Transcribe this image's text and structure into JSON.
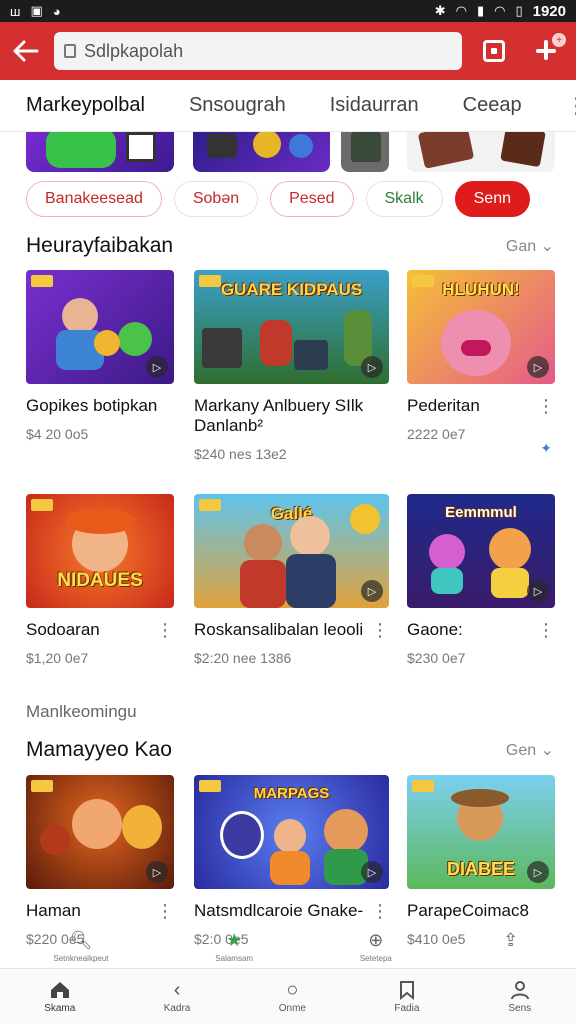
{
  "status_bar": {
    "time": "1920"
  },
  "app_bar": {
    "search_value": "Sdlpkapolah"
  },
  "tabs": [
    {
      "label": "Markeypolbal"
    },
    {
      "label": "Snsougrah"
    },
    {
      "label": "Isidaurran"
    },
    {
      "label": "Ceeap"
    }
  ],
  "chips": [
    {
      "label": "Banakeesead"
    },
    {
      "label": "Sobən"
    },
    {
      "label": "Pesed"
    },
    {
      "label": "Skalk"
    },
    {
      "label": "Senn"
    }
  ],
  "section1": {
    "title": "Heurayfaibakan",
    "link": "Gan ⌄",
    "cards": [
      {
        "title": "Gopikes botipkan",
        "meta": "$4 20 0o5",
        "art": ""
      },
      {
        "title": "Markany Anlbuery SIlk Danlanb²",
        "meta": "$240 nes 13e2",
        "art": "GUARE KIDPAUS"
      },
      {
        "title": "Pederitan",
        "meta": "2222 0e7",
        "art": "HLUHUN!"
      },
      {
        "title": "Sodoaran",
        "meta": "$1,20 0e7",
        "art": "NIDAUES"
      },
      {
        "title": "Roskansalibalan leooli",
        "meta": "$2:20 nee 1386",
        "art": "Gallé"
      },
      {
        "title": "Gaone:",
        "meta": "$230 0e7",
        "art": "Eemmmul"
      }
    ]
  },
  "section2": {
    "subtitle": "Manlkeomingu",
    "title": "Mamayyeo Kao",
    "link": "Gen ⌄",
    "cards": [
      {
        "title": "Haman",
        "meta": "$220 0e5",
        "art": ""
      },
      {
        "title": "Natsmdlcaroie Gnake-",
        "meta": "$2:0 0e5",
        "art": "MARPAGS"
      },
      {
        "title": "ParapeCoimac8",
        "meta": "$410 0e5",
        "art": "DIABEE"
      }
    ]
  },
  "overlay_strip": [
    {
      "label": "Setnknealkpeut"
    },
    {
      "label": "Salamsam"
    },
    {
      "label": "Setetepa"
    },
    {
      "label": ""
    }
  ],
  "bottom_nav": [
    {
      "label": "Skama",
      "icon": "home-icon"
    },
    {
      "label": "Kadra",
      "icon": "back-icon"
    },
    {
      "label": "Onme",
      "icon": "circle-icon"
    },
    {
      "label": "Fadia",
      "icon": "bookmark-icon"
    },
    {
      "label": "Sens",
      "icon": "profile-icon"
    }
  ],
  "colors": {
    "brand_red": "#d32f2f",
    "chip_active": "#e01b1b"
  }
}
